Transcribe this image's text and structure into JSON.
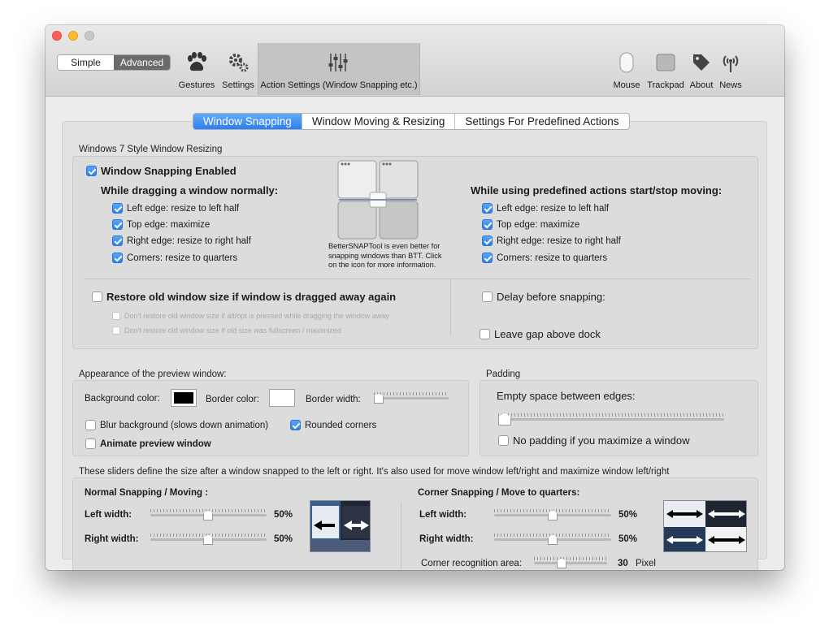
{
  "window": {
    "mode": {
      "simple": "Simple",
      "advanced": "Advanced"
    },
    "toolbar": {
      "gestures": "Gestures",
      "settings": "Settings",
      "action_settings": "Action Settings (Window Snapping etc.)",
      "mouse": "Mouse",
      "trackpad": "Trackpad",
      "about": "About",
      "news": "News"
    }
  },
  "tabs": [
    "Window Snapping",
    "Window Moving & Resizing",
    "Settings For Predefined Actions"
  ],
  "snap_section": {
    "title": "Windows 7 Style Window Resizing",
    "enabled_label": "Window Snapping Enabled",
    "dragging_header": "While dragging a window normally:",
    "dragging_items": [
      {
        "label": "Left edge: resize to left half",
        "checked": true
      },
      {
        "label": "Top edge: maximize",
        "checked": true
      },
      {
        "label": "Right edge: resize to right half",
        "checked": true
      },
      {
        "label": "Corners: resize to quarters",
        "checked": true
      }
    ],
    "predefined_header": "While using predefined actions start/stop moving:",
    "predefined_items": [
      {
        "label": "Left edge: resize to left half",
        "checked": true
      },
      {
        "label": "Top edge: maximize",
        "checked": true
      },
      {
        "label": "Right edge: resize to right half",
        "checked": true
      },
      {
        "label": "Corners: resize to quarters",
        "checked": true
      }
    ],
    "bst_note": "BetterSNAPTool is even better for snapping windows than BTT. Click on the icon for more information.",
    "restore_label": "Restore old window size if window is dragged away again",
    "restore_sub1": "Don't restore old window size if alt/opt is pressed while dragging the window away",
    "restore_sub2": "Don't restore old window size if old size was fullscreen / maximized",
    "delay_label": "Delay before snapping:",
    "gap_label": "Leave gap above dock"
  },
  "preview": {
    "title": "Appearance of the preview window:",
    "bg_color_label": "Background color:",
    "bg_color": "#000000",
    "border_color_label": "Border color:",
    "border_color": "#ffffff",
    "border_width_label": "Border width:",
    "border_width_level": 0,
    "blur_label": "Blur background (slows down animation)",
    "rounded_label": "Rounded corners",
    "animate_label": "Animate preview window"
  },
  "padding": {
    "title": "Padding",
    "space_label": "Empty space between edges:",
    "space_level": 0,
    "no_padding_label": "No padding if you maximize a window"
  },
  "sizes": {
    "description": "These sliders define the size after a window snapped to the left or right. It's also used for move window left/right and maximize window left/right",
    "normal_header": "Normal Snapping / Moving :",
    "corner_header": "Corner Snapping / Move to quarters:",
    "left_width_label": "Left width:",
    "right_width_label": "Right width:",
    "normal_left_value": "50%",
    "normal_right_value": "50%",
    "corner_left_value": "50%",
    "corner_right_value": "50%",
    "corner_area_label": "Corner recognition area:",
    "corner_area_value": "30",
    "corner_area_unit": "Pixel"
  },
  "colors": {
    "accent": "#2c7ff2",
    "window_bg": "#ececec"
  }
}
